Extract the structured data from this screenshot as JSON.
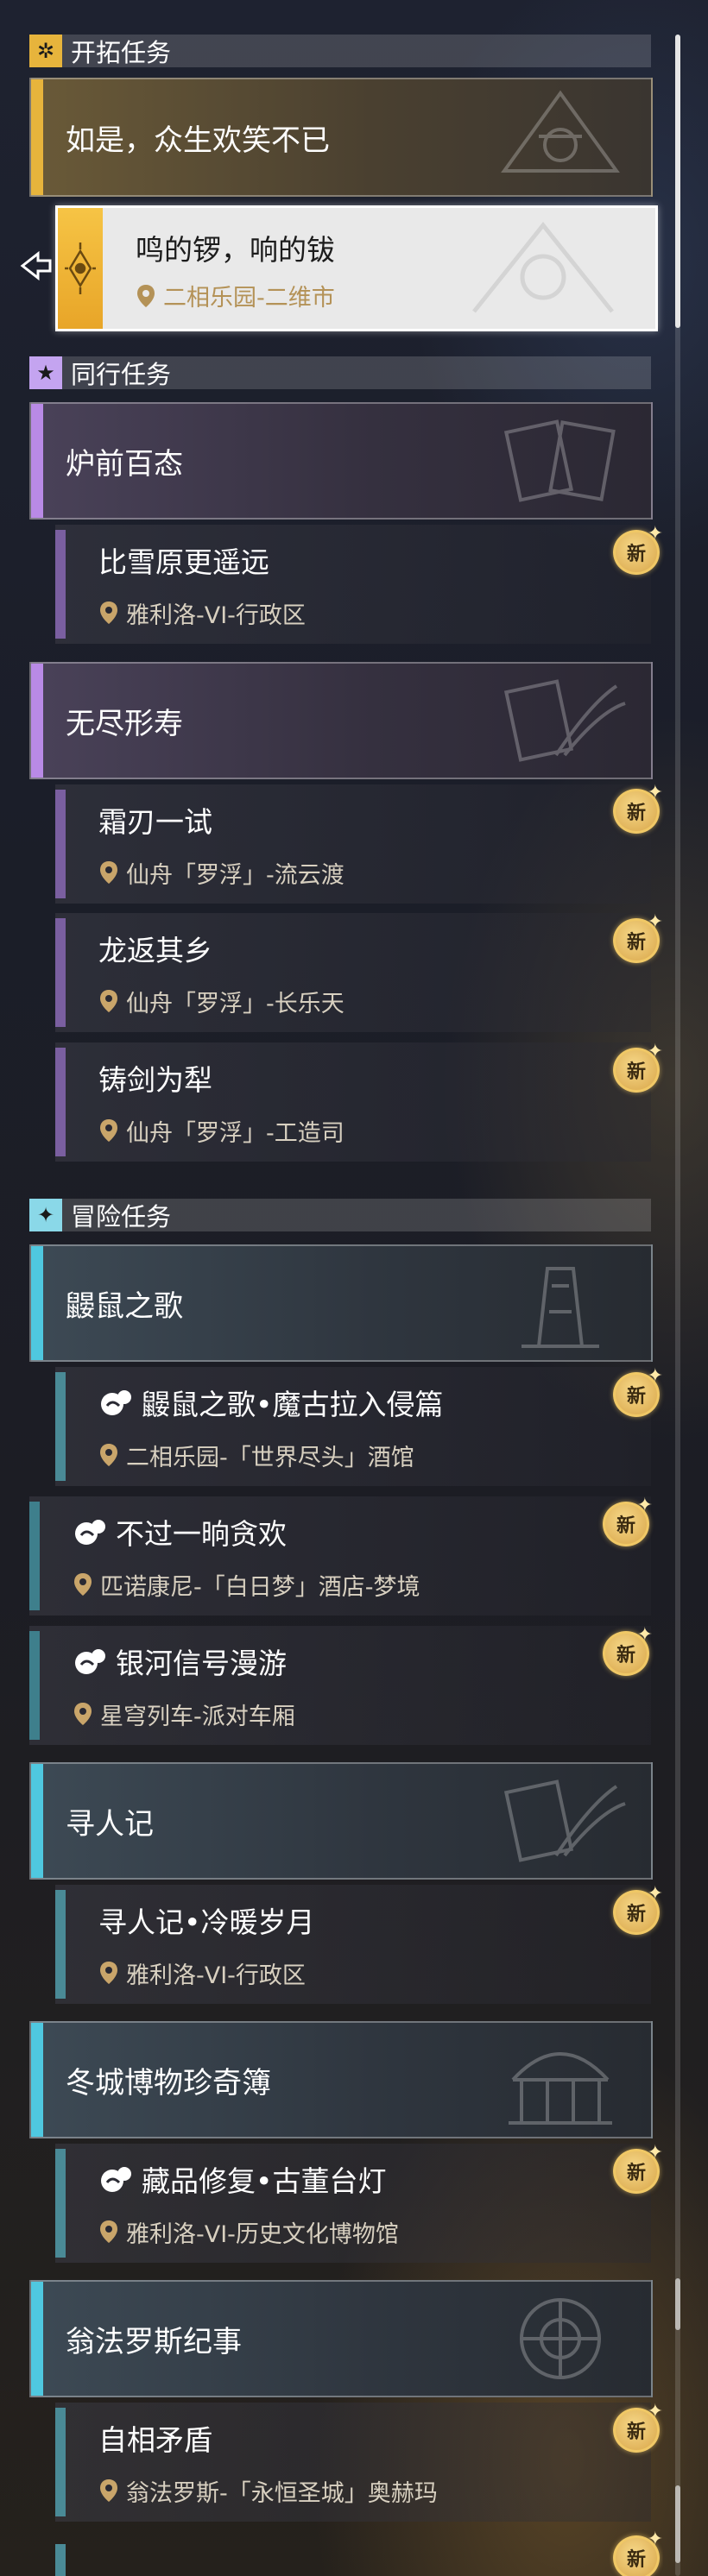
{
  "sections": {
    "trailblaze": {
      "title": "开拓任务",
      "icon": "trailblaze-icon"
    },
    "companion": {
      "title": "同行任务",
      "icon": "star-icon"
    },
    "adventure": {
      "title": "冒险任务",
      "icon": "diamond-sparkle-icon"
    }
  },
  "trailblaze_group": {
    "title": "如是，众生欢笑不已"
  },
  "selected_quest": {
    "title": "鸣的锣，响的钹",
    "location": "二相乐园-二维市"
  },
  "groups": {
    "g1": {
      "title": "炉前百态"
    },
    "g2": {
      "title": "无尽形寿"
    },
    "g3": {
      "title": "鼹鼠之歌"
    },
    "g4": {
      "title": "寻人记"
    },
    "g5": {
      "title": "冬城博物珍奇簿"
    },
    "g6": {
      "title": "翁法罗斯纪事"
    }
  },
  "quests": [
    {
      "title": "比雪原更遥远",
      "location": "雅利洛-VI-行政区",
      "badge": "新"
    },
    {
      "title": "霜刃一试",
      "location": "仙舟「罗浮」-流云渡",
      "badge": "新"
    },
    {
      "title": "龙返其乡",
      "location": "仙舟「罗浮」-长乐天",
      "badge": "新"
    },
    {
      "title": "铸剑为犁",
      "location": "仙舟「罗浮」-工造司",
      "badge": "新"
    },
    {
      "title": "鼹鼠之歌•魔古拉入侵篇",
      "location": "二相乐园-「世界尽头」酒馆",
      "badge": "新"
    },
    {
      "title": "不过一晌贪欢",
      "location": "匹诺康尼-「白日梦」酒店-梦境",
      "badge": "新"
    },
    {
      "title": "银河信号漫游",
      "location": "星穹列车-派对车厢",
      "badge": "新"
    },
    {
      "title": "寻人记•冷暖岁月",
      "location": "雅利洛-VI-行政区",
      "badge": "新"
    },
    {
      "title": "藏品修复•古董台灯",
      "location": "雅利洛-VI-历史文化博物馆",
      "badge": "新"
    },
    {
      "title": "自相矛盾",
      "location": "翁法罗斯-「永恒圣城」奥赫玛",
      "badge": "新"
    }
  ],
  "extra_badge": "新",
  "colors": {
    "trailblaze": "#e7b43c",
    "companion": "#b98ae6",
    "adventure": "#4fc8e0"
  }
}
